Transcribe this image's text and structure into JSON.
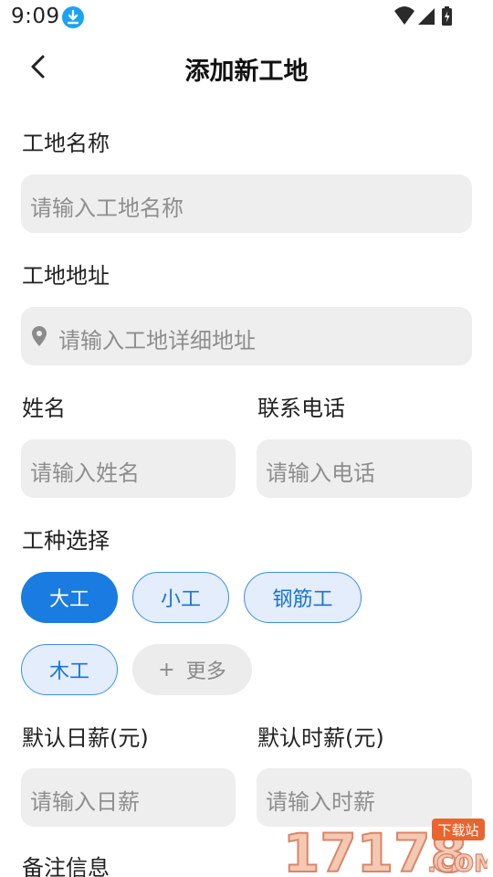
{
  "status": {
    "time": "9:09"
  },
  "header": {
    "title": "添加新工地"
  },
  "form": {
    "site_name": {
      "label": "工地名称",
      "placeholder": "请输入工地名称"
    },
    "site_address": {
      "label": "工地地址",
      "placeholder": "请输入工地详细地址"
    },
    "name": {
      "label": "姓名",
      "placeholder": "请输入姓名"
    },
    "phone": {
      "label": "联系电话",
      "placeholder": "请输入电话"
    },
    "trade": {
      "label": "工种选择",
      "options": [
        "大工",
        "小工",
        "钢筋工",
        "木工"
      ],
      "selected": "大工",
      "more_label": "更多"
    },
    "daily_wage": {
      "label": "默认日薪(元)",
      "placeholder": "请输入日薪"
    },
    "hourly_wage": {
      "label": "默认时薪(元)",
      "placeholder": "请输入时薪"
    },
    "notes": {
      "label": "备注信息"
    }
  },
  "watermark": {
    "brand": "17178",
    "suffix": ".COM",
    "tag": "下载站"
  },
  "colors": {
    "accent": "#1a7be0",
    "chip_outline_bg": "#e3edfb",
    "input_bg": "#eeeeee"
  }
}
